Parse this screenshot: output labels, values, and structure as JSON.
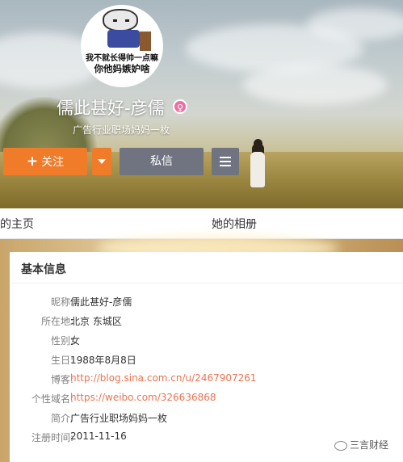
{
  "profile": {
    "avatar_caption_line1": "我不就长得帅一点嘛",
    "avatar_caption_line2": "你他妈嫉妒啥",
    "name": "儒此甚好-彦儒",
    "verified_badge": "♀",
    "bio": "广告行业职场妈妈一枚"
  },
  "actions": {
    "follow_plus": "+",
    "follow_label": "关注",
    "message_label": "私信"
  },
  "tabs": {
    "home": "的主页",
    "album": "她的相册"
  },
  "info": {
    "title": "基本信息",
    "rows": [
      {
        "label": "昵称:",
        "value": "儒此甚好-彦儒"
      },
      {
        "label": "所在地:",
        "value": "北京 东城区"
      },
      {
        "label": "性别:",
        "value": "女"
      },
      {
        "label": "生日:",
        "value": "1988年8月8日"
      },
      {
        "label": "博客:",
        "value": "http://blog.sina.com.cn/u/2467907261"
      },
      {
        "label": "个性域名:",
        "value": "https://weibo.com/326636868"
      },
      {
        "label": "简介:",
        "value": "广告行业职场妈妈一枚"
      },
      {
        "label": "注册时间:",
        "value": "2011-11-16"
      }
    ]
  },
  "watermark": "三言财经",
  "colors": {
    "follow": "#f07c2a",
    "secondary_button": "#6f7480",
    "link": "#eb7350",
    "badge": "#ec6fa4"
  },
  "icons": [
    "plus-icon",
    "chevron-down-icon",
    "menu-icon",
    "female-badge-icon",
    "wechat-icon"
  ]
}
